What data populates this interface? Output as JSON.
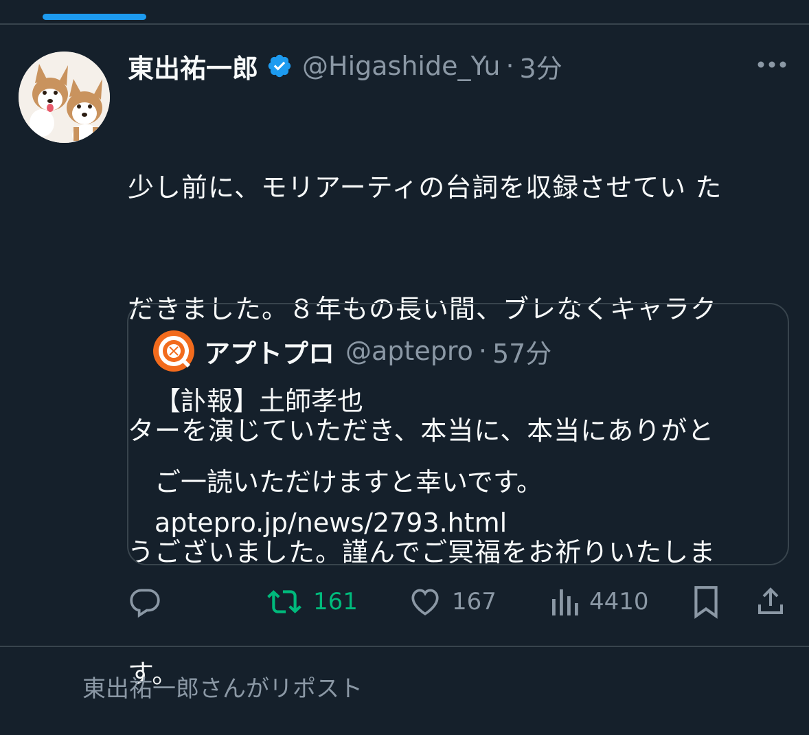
{
  "tweet": {
    "display_name": "東出祐一郎",
    "handle": "@Higashide_Yu",
    "separator": "·",
    "time": "3分",
    "text_lines": [
      "少し前に、モリアーティの台詞を収録させてい た",
      "だきました。８年もの長い間、ブレなくキャラク",
      "ターを演じていただき、本当に、本当にありがと",
      "うございました。謹んでご冥福をお祈りいたしま",
      "す。"
    ]
  },
  "quote": {
    "display_name": "アプトプロ",
    "handle": "@aptepro",
    "separator": "·",
    "time": "57分",
    "lines": [
      "【訃報】土師孝也",
      "",
      "ご一読いただけますと幸いです。",
      "aptepro.jp/news/2793.html"
    ]
  },
  "actions": {
    "reply_count": "",
    "retweet_count": "161",
    "like_count": "167",
    "views_count": "4410"
  },
  "colors": {
    "background": "#15202b",
    "accent": "#1d9bf0",
    "retweet_green": "#00ba7c",
    "secondary_text": "#8b98a5"
  },
  "next_item_text": "東出祐一郎さんがリポスト"
}
